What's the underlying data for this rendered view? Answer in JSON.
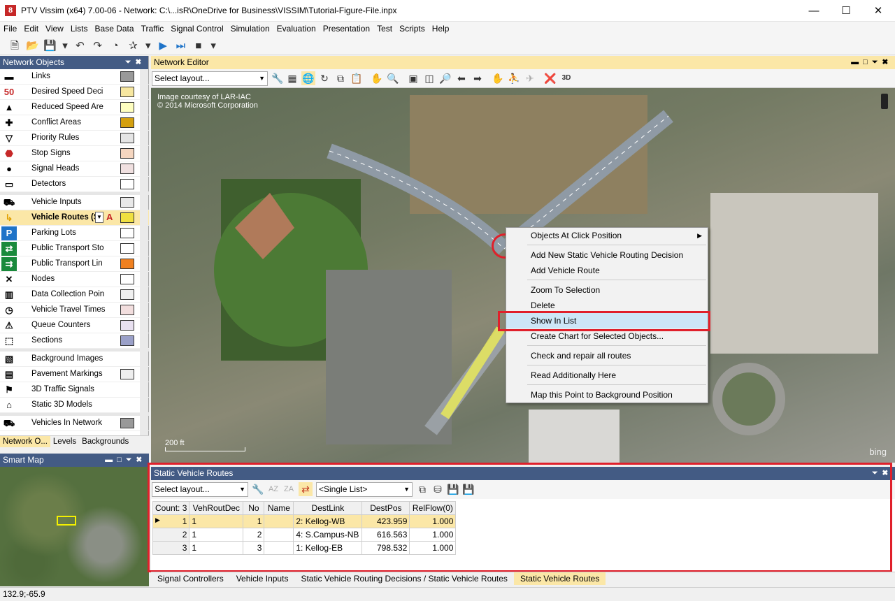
{
  "window": {
    "title": "PTV Vissim (x64) 7.00-06 - Network: C:\\...isR\\OneDrive for Business\\VISSIM\\Tutorial-Figure-File.inpx",
    "app_icon_glyph": "8"
  },
  "menu": [
    "File",
    "Edit",
    "View",
    "Lists",
    "Base Data",
    "Traffic",
    "Signal Control",
    "Simulation",
    "Evaluation",
    "Presentation",
    "Test",
    "Scripts",
    "Help"
  ],
  "network_objects": {
    "title": "Network Objects",
    "items": [
      {
        "label": "Links",
        "icon": "links-icon",
        "swatch": "#999999"
      },
      {
        "label": "Desired Speed Deci",
        "icon": "speed-50-icon",
        "swatch": "#f7e7a0"
      },
      {
        "label": "Reduced Speed Are",
        "icon": "reduced-speed-icon",
        "swatch": "#ffffc0"
      },
      {
        "label": "Conflict Areas",
        "icon": "conflict-icon",
        "swatch": "#d4a010"
      },
      {
        "label": "Priority Rules",
        "icon": "priority-icon",
        "swatch": "#e5e5e5"
      },
      {
        "label": "Stop Signs",
        "icon": "stop-sign-icon",
        "swatch": "#f5d6c0"
      },
      {
        "label": "Signal Heads",
        "icon": "signal-head-icon",
        "swatch": "#f0e0e0"
      },
      {
        "label": "Detectors",
        "icon": "detector-icon",
        "swatch": "#ffffff"
      },
      {
        "label": "Vehicle Inputs",
        "icon": "vehicle-input-icon",
        "swatch": "#e8e8e8"
      },
      {
        "label": "Vehicle Routes (St",
        "icon": "vehicle-route-icon",
        "swatch": "#f0e040"
      },
      {
        "label": "Parking Lots",
        "icon": "parking-icon",
        "swatch": "#ffffff"
      },
      {
        "label": "Public Transport Sto",
        "icon": "pt-stop-icon",
        "swatch": "#ffffff"
      },
      {
        "label": "Public Transport Lin",
        "icon": "pt-line-icon",
        "swatch": "#f08020"
      },
      {
        "label": "Nodes",
        "icon": "nodes-icon",
        "swatch": "#ffffff"
      },
      {
        "label": "Data Collection Poin",
        "icon": "data-collection-icon",
        "swatch": "#f0f0f0"
      },
      {
        "label": "Vehicle Travel Times",
        "icon": "travel-time-icon",
        "swatch": "#f2dede"
      },
      {
        "label": "Queue Counters",
        "icon": "queue-counter-icon",
        "swatch": "#e8e0f0"
      },
      {
        "label": "Sections",
        "icon": "sections-icon",
        "swatch": "#9aa0c8"
      },
      {
        "label": "Background Images",
        "icon": "background-image-icon",
        "swatch": ""
      },
      {
        "label": "Pavement Markings",
        "icon": "pavement-icon",
        "swatch": "#eeeeee"
      },
      {
        "label": "3D Traffic Signals",
        "icon": "3d-signal-icon",
        "swatch": ""
      },
      {
        "label": "Static 3D Models",
        "icon": "3d-model-icon",
        "swatch": ""
      },
      {
        "label": "Vehicles In Network",
        "icon": "vehicle-network-icon",
        "swatch": "#999999"
      }
    ],
    "tabs": [
      "Network O...",
      "Levels",
      "Backgrounds"
    ]
  },
  "smart_map": {
    "title": "Smart Map"
  },
  "network_editor": {
    "title": "Network Editor",
    "layout_placeholder": "Select layout...",
    "credit_line1": "Image courtesy of LAR-IAC",
    "credit_line2": "© 2014 Microsoft Corporation",
    "scale_label": "200 ft",
    "bing": "bing"
  },
  "context_menu": {
    "items": [
      {
        "label": "Objects At Click Position",
        "submenu": true
      },
      {
        "label": "Add New Static Vehicle Routing Decision"
      },
      {
        "label": "Add Vehicle Route"
      },
      {
        "label": "Zoom To Selection"
      },
      {
        "label": "Delete"
      },
      {
        "label": "Show In List",
        "highlighted": true
      },
      {
        "label": "Create Chart for Selected Objects..."
      },
      {
        "label": "Check and repair all routes"
      },
      {
        "label": "Read Additionally Here"
      },
      {
        "label": "Map this Point to Background Position"
      }
    ]
  },
  "routes_panel": {
    "title": "Static Vehicle Routes",
    "layout_placeholder": "Select layout...",
    "list_mode": "<Single List>",
    "columns": [
      "Count: 3",
      "VehRoutDec",
      "No",
      "Name",
      "DestLink",
      "DestPos",
      "RelFlow(0)"
    ],
    "rows": [
      {
        "idx": "1",
        "dec": "1",
        "no": "1",
        "name": "",
        "dest": "2: Kellog-WB",
        "pos": "423.959",
        "flow": "1.000",
        "selected": true
      },
      {
        "idx": "2",
        "dec": "1",
        "no": "2",
        "name": "",
        "dest": "4: S.Campus-NB",
        "pos": "616.563",
        "flow": "1.000"
      },
      {
        "idx": "3",
        "dec": "1",
        "no": "3",
        "name": "",
        "dest": "1: Kellog-EB",
        "pos": "798.532",
        "flow": "1.000"
      }
    ]
  },
  "bottom_tabs": [
    "Signal Controllers",
    "Vehicle Inputs",
    "Static Vehicle Routing Decisions / Static Vehicle Routes",
    "Static Vehicle Routes"
  ],
  "status": {
    "coords": "132.9;-65.9"
  },
  "colors": {
    "annotation_red": "#e0202b",
    "panel_header": "#435b84",
    "active_header": "#fbe7a7",
    "menu_highlight": "#cde6f7"
  }
}
